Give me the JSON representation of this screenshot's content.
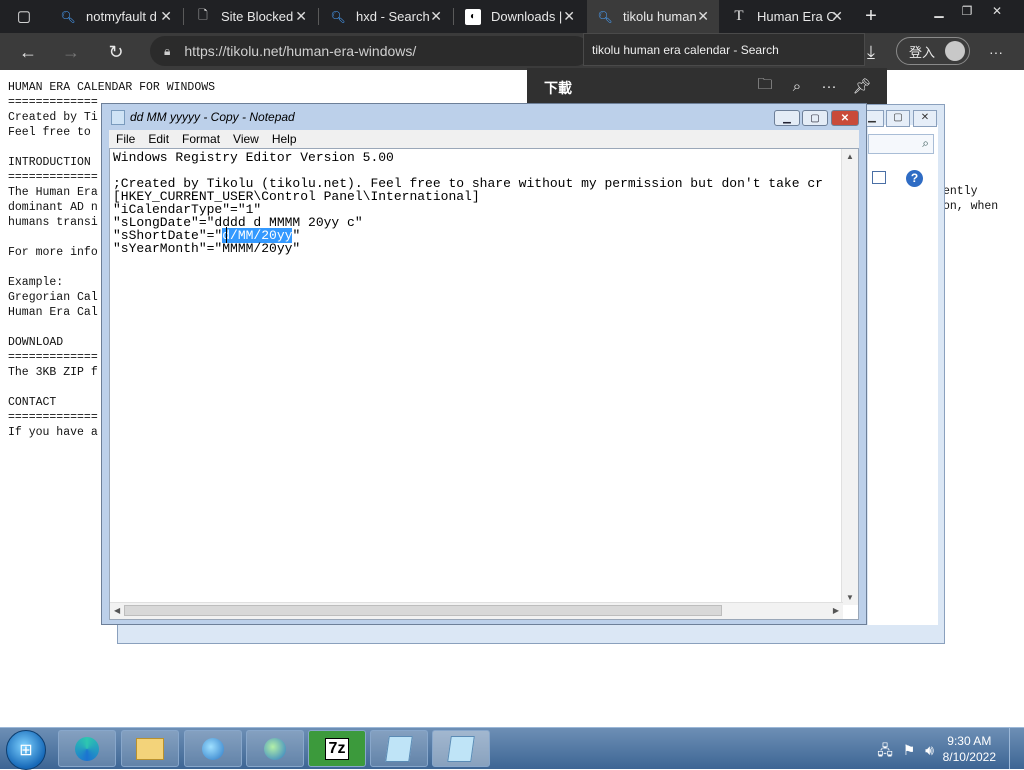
{
  "browser": {
    "tabs": [
      {
        "label": "notmyfault d",
        "icon": "search-icon"
      },
      {
        "label": "Site Blocked",
        "icon": "document-icon"
      },
      {
        "label": "hxd - Search",
        "icon": "search-icon"
      },
      {
        "label": "Downloads |",
        "icon": "site-logo-icon"
      },
      {
        "label": "tikolu human",
        "icon": "search-icon"
      },
      {
        "label": "Human Era C",
        "icon": "text-icon"
      }
    ],
    "tab_close_glyph": "✕",
    "new_tab_glyph": "+",
    "url": "https://tikolu.net/human-era-windows/",
    "tooltip": "tikolu human era calendar - Search",
    "login_label": "登入",
    "menu_glyph": "···"
  },
  "downloads_panel": {
    "title": "下載"
  },
  "page_text": {
    "lines": [
      "HUMAN ERA CALENDAR FOR WINDOWS",
      "=============",
      "Created by Ti",
      "Feel free to",
      "",
      "INTRODUCTION",
      "=============",
      "The Human Era",
      "dominant AD n",
      "humans transi",
      "",
      "For more info",
      "",
      "Example:",
      "Gregorian Cal",
      "Human Era Cal",
      "",
      "DOWNLOAD",
      "=============",
      "The 3KB ZIP f",
      "",
      "CONTACT",
      "=============",
      "If you have a"
    ],
    "right_fragment_1": "ently",
    "right_fragment_2": "on, when"
  },
  "notepad": {
    "title": "dd MM yyyyy - Copy - Notepad",
    "menu": [
      "File",
      "Edit",
      "Format",
      "View",
      "Help"
    ],
    "lines": [
      "Windows Registry Editor Version 5.00",
      "",
      ";Created by Tikolu (tikolu.net). Feel free to share without my permission but don't take cr",
      "[HKEY_CURRENT_USER\\Control Panel\\International]",
      "\"iCalendarType\"=\"1\"",
      "\"sLongDate\"=\"dddd d MMMM 20yy c\""
    ],
    "short_date_prefix": "\"sShortDate\"=\"",
    "short_date_selected": "d/MM/20yy",
    "short_date_suffix": "\"",
    "year_month_line": "\"sYearMonth\"=\"MMMM/20yy\""
  },
  "taskbar": {
    "items": [
      "explorer-icon",
      "edge-icon",
      "folder-icon",
      "network-globe-icon",
      "network-settings-icon",
      "7zip-icon",
      "notepad-icon",
      "notepad-icon"
    ],
    "seven_zip_label": "7z",
    "time": "9:30 AM",
    "date": "8/10/2022"
  },
  "colors": {
    "selection": "#3399ff",
    "browser_dark": "#202124",
    "taskbar": "#3d6594"
  }
}
